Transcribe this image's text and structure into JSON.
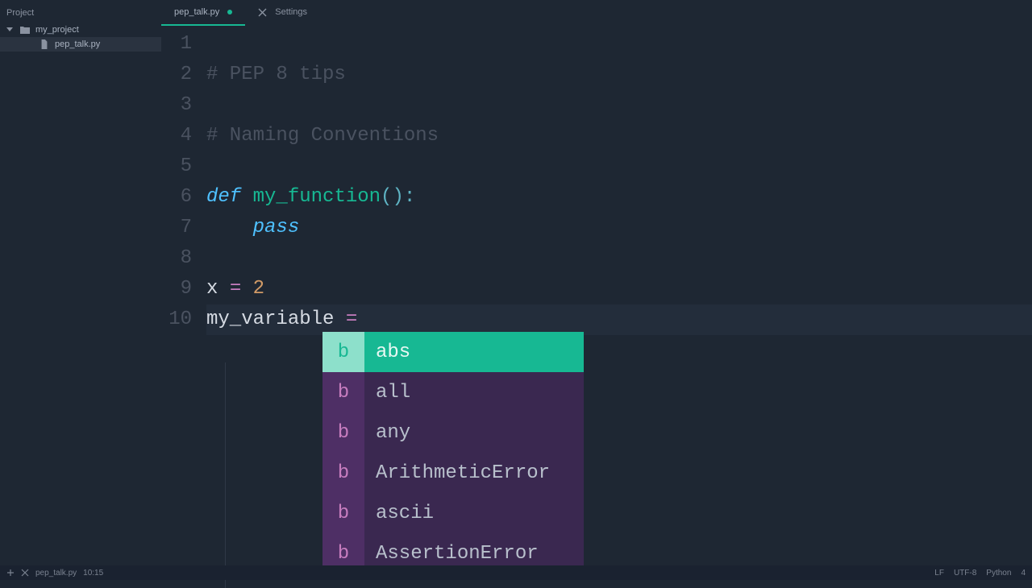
{
  "sidebar": {
    "title": "Project",
    "folder": "my_project",
    "file": "pep_talk.py"
  },
  "tabs": [
    {
      "label": "pep_talk.py",
      "modified": true,
      "active": true
    },
    {
      "label": "Settings",
      "modified": false,
      "active": false
    }
  ],
  "code": {
    "line_numbers": [
      "1",
      "2",
      "3",
      "4",
      "5",
      "6",
      "7",
      "8",
      "9",
      "10"
    ],
    "comment1": "# PEP 8 tips",
    "comment2": "# Naming Conventions",
    "def_kw": "def",
    "func_name": " my_function",
    "func_parens": "():",
    "pass_kw": "pass",
    "var_x": "x ",
    "eq1": "=",
    "num2": " 2",
    "var_my": "my_variable ",
    "eq2": "=",
    "indent4": "    "
  },
  "autocomplete": {
    "icon_letter": "b",
    "items": [
      "abs",
      "all",
      "any",
      "ArithmeticError",
      "ascii",
      "AssertionError"
    ],
    "selected_index": 0
  },
  "statusbar": {
    "filename": "pep_talk.py",
    "cursor": "10:15",
    "line_ending": "LF",
    "encoding": "UTF-8",
    "language": "Python",
    "tab_size": "4"
  }
}
